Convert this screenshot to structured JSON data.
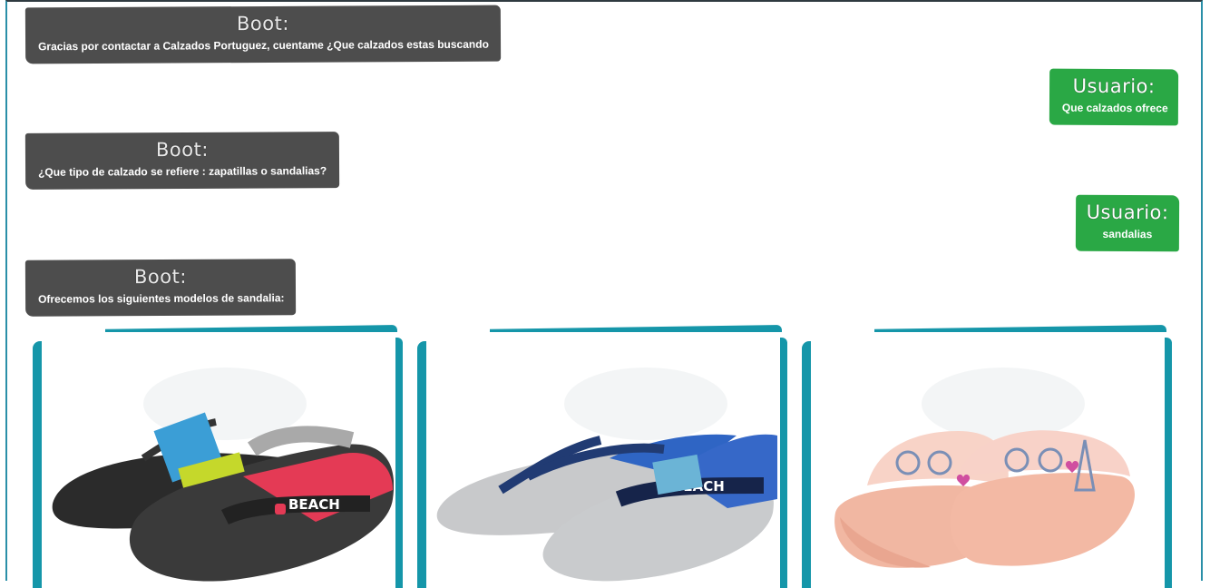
{
  "chat": {
    "messages": [
      {
        "sender": "Boot:",
        "text": "Gracias por contactar a Calzados Portuguez, cuentame ¿Que calzados estas buscando"
      },
      {
        "sender": "Usuario:",
        "text": "Que calzados ofrece"
      },
      {
        "sender": "Boot:",
        "text": "¿Que tipo de calzado se refiere : zapatillas o sandalias?"
      },
      {
        "sender": "Usuario:",
        "text": "sandalias"
      },
      {
        "sender": "Boot:",
        "text": "Ofrecemos los siguientes modelos de sandalia:"
      }
    ]
  },
  "products": [
    {
      "name": "black-red-beach-flip-flop",
      "brand_text": "BEACH"
    },
    {
      "name": "navy-blue-beach-flip-flop",
      "brand_text": "BEACH"
    },
    {
      "name": "pink-bicycle-slide",
      "brand_text": ""
    }
  ],
  "colors": {
    "bot_bubble": "#4d4d4d",
    "user_bubble": "#2aa845",
    "card_border": "#1596a9",
    "frame_border": "#2a8fa8"
  }
}
